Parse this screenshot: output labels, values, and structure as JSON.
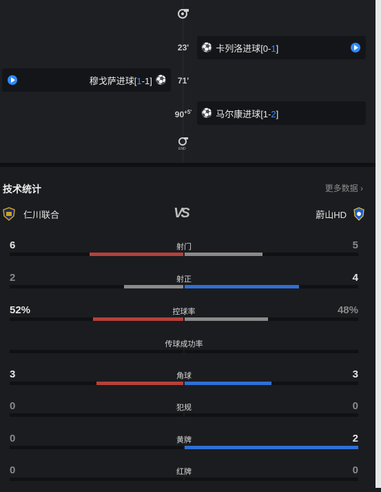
{
  "timeline": {
    "events": [
      {
        "minute": "23'",
        "side": "away",
        "text_pre": "卡列洛进球[0-",
        "score_hl": "1",
        "text_post": "]"
      },
      {
        "minute": "71'",
        "side": "home",
        "text_pre": "穆戈萨进球[",
        "score_hl": "1",
        "text_post": "-1]"
      },
      {
        "minute_main": "90",
        "minute_extra": "+5'",
        "side": "away",
        "text_pre": "马尔康进球[1-",
        "score_hl": "2",
        "text_post": "]"
      }
    ],
    "end_label": "END"
  },
  "stats": {
    "title": "技术统计",
    "more": "更多数据 ›",
    "home_team": "仁川联合",
    "away_team": "蔚山HD",
    "vs": "VS",
    "rows": [
      {
        "label": "射门",
        "home": "6",
        "away": "5",
        "home_frac": 0.54,
        "away_frac": 0.45,
        "home_color": "#b8403a",
        "away_color": "#8a8a8a"
      },
      {
        "label": "射正",
        "home": "2",
        "away": "4",
        "home_frac": 0.34,
        "away_frac": 0.66,
        "home_color": "#8a8a8a",
        "away_color": "#2f6fd6"
      },
      {
        "label": "控球率",
        "home": "52%",
        "away": "48%",
        "home_frac": 0.52,
        "away_frac": 0.48,
        "home_color": "#b8403a",
        "away_color": "#8a8a8a"
      },
      {
        "label": "传球成功率",
        "home": "",
        "away": "",
        "home_frac": 0,
        "away_frac": 0,
        "home_color": "#b8403a",
        "away_color": "#8a8a8a"
      },
      {
        "label": "角球",
        "home": "3",
        "away": "3",
        "home_frac": 0.5,
        "away_frac": 0.5,
        "home_color": "#b8403a",
        "away_color": "#2f6fd6"
      },
      {
        "label": "犯规",
        "home": "0",
        "away": "0",
        "home_frac": 0,
        "away_frac": 0,
        "home_color": "#b8403a",
        "away_color": "#8a8a8a"
      },
      {
        "label": "黄牌",
        "home": "0",
        "away": "2",
        "home_frac": 0,
        "away_frac": 1.0,
        "home_color": "#b8403a",
        "away_color": "#2f6fd6"
      },
      {
        "label": "红牌",
        "home": "0",
        "away": "0",
        "home_frac": 0,
        "away_frac": 0,
        "home_color": "#b8403a",
        "away_color": "#8a8a8a"
      }
    ]
  }
}
